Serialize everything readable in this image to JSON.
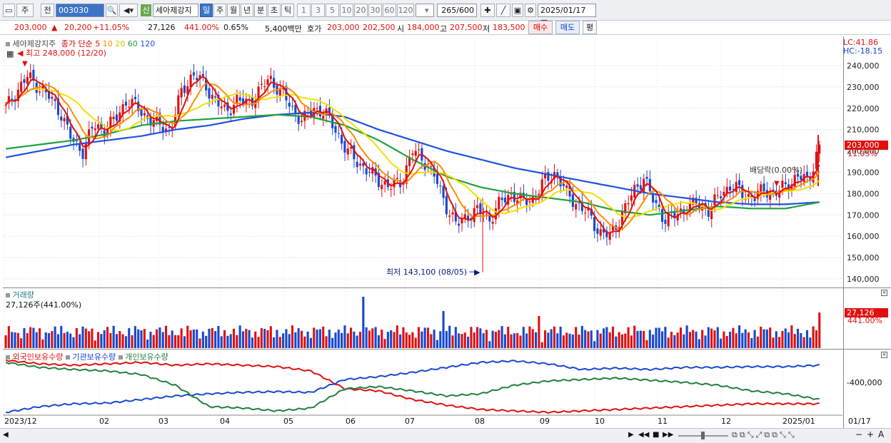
{
  "toolbar": {
    "tab1": "주",
    "tab2": "전",
    "code": "003030",
    "badge": "신",
    "stock_name": "세아제강지",
    "periods": [
      "일",
      "주",
      "월",
      "년",
      "분",
      "초",
      "틱"
    ],
    "selected_period": "일",
    "nums": [
      "1",
      "3",
      "5",
      "10",
      "20",
      "30",
      "60",
      "120"
    ],
    "count": "265",
    "count_total": "/600",
    "date": "2025/01/17"
  },
  "quote": {
    "price": "203,000",
    "change": "20,200",
    "change_pct": "+11.05%",
    "volume": "27,126",
    "vol_pct": "441.00%",
    "turnover": "0.65%",
    "amount": "5,400백만",
    "bid_label": "호가",
    "bid": "203,000",
    "ask": "202,500",
    "open_label": "시",
    "open": "184,000",
    "high_label": "고",
    "high": "207,500",
    "low_label": "저",
    "low": "183,500",
    "buy": "매수",
    "sell": "매도",
    "eval": "평"
  },
  "price_panel": {
    "legend_name": "세아제강지주",
    "legend_type": "종가 단순",
    "ma_periods": [
      "5",
      "10",
      "20",
      "60",
      "120"
    ],
    "ma_colors": [
      "#e01010",
      "#ff8c00",
      "#f0e000",
      "#20a040",
      "#2050e0"
    ],
    "high_note": "최고 248,000 (12/20)",
    "low_note": "최저 143,100 (08/05)",
    "dividend_note": "배당락(0.00%)",
    "lc": "LC:41.86",
    "hc": "HC:-18.15",
    "yticks": [
      "240,000",
      "230,000",
      "220,000",
      "210,000",
      "200,000",
      "190,000",
      "180,000",
      "170,000",
      "160,000",
      "150,000",
      "140,000"
    ],
    "price_tag": "203,000",
    "pct_tag": "11.05%"
  },
  "volume_panel": {
    "title": "거래량",
    "value": "27,126주(441.00%)",
    "tag": "27,126",
    "tag_pct": "441.00%"
  },
  "holding_panel": {
    "series": [
      "외국인보유수량",
      "기관보유수량",
      "개인보유수량"
    ],
    "ytick": "-400,000"
  },
  "xaxis": [
    "2023/12",
    "02",
    "03",
    "04",
    "05",
    "06",
    "07",
    "08",
    "09",
    "10",
    "11",
    "12",
    "2025/01"
  ],
  "xaxis_right": "01/17",
  "chart_data": {
    "type": "candlestick",
    "ylim": [
      140000,
      240000
    ],
    "high": 248000,
    "low": 143100,
    "last_close": 203000,
    "close_path": [
      220000,
      228000,
      235000,
      230000,
      225000,
      218000,
      205000,
      200000,
      212000,
      210000,
      215000,
      224000,
      220000,
      215000,
      212000,
      210000,
      228000,
      236000,
      232000,
      224000,
      218000,
      224000,
      222000,
      228000,
      234000,
      228000,
      220000,
      214000,
      220000,
      218000,
      210000,
      200000,
      195000,
      190000,
      186000,
      183000,
      186000,
      200000,
      196000,
      188000,
      175000,
      165000,
      170000,
      172000,
      168000,
      176000,
      180000,
      176000,
      178000,
      186000,
      190000,
      180000,
      175000,
      170000,
      162000,
      160000,
      170000,
      180000,
      188000,
      175000,
      168000,
      170000,
      174000,
      175000,
      172000,
      180000,
      184000,
      180000,
      178000,
      182000,
      180000,
      184000,
      188000,
      186000,
      203000
    ],
    "ma120": [
      197000,
      200000,
      203000,
      205000,
      207000,
      210000,
      212000,
      215000,
      217000,
      218000,
      216000,
      210000,
      205000,
      200000,
      196000,
      192000,
      189000,
      186000,
      183000,
      180000,
      178000,
      176000,
      175000,
      175000,
      176000
    ],
    "ma60": [
      201000,
      203000,
      205000,
      208000,
      212000,
      214000,
      215000,
      216000,
      217000,
      216000,
      212000,
      205000,
      196000,
      188000,
      183000,
      180000,
      178000,
      176000,
      172000,
      170000,
      172000,
      174000,
      173000,
      173000,
      176000
    ],
    "volume_last": 27126
  }
}
